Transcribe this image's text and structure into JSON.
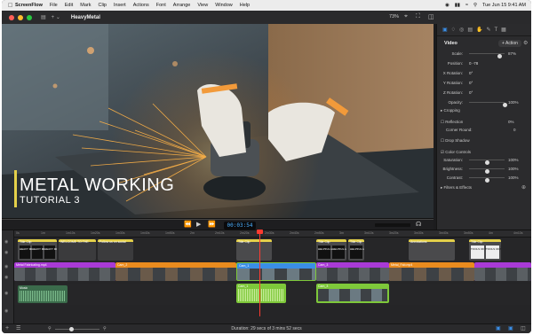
{
  "menubar": {
    "app_name": "ScreenFlow",
    "items": [
      "File",
      "Edit",
      "Mark",
      "Clip",
      "Insert",
      "Actions",
      "Font",
      "Arrange",
      "View",
      "Window",
      "Help"
    ],
    "clock": "Tue Jun 15 9:41 AM"
  },
  "titlebar": {
    "document_title": "HeavyMetal",
    "zoom": "73%"
  },
  "video": {
    "title_line1": "METAL WORKING",
    "title_line2": "TUTORIAL 3"
  },
  "transport": {
    "timecode": "00:03:54"
  },
  "inspector": {
    "section_title": "Video",
    "action_button": "+ Action",
    "rows": [
      {
        "label": "Scale:",
        "value": "",
        "pct": "87%",
        "slider": 0.87
      },
      {
        "label": "Position:",
        "value": "0      -78",
        "pct": ""
      },
      {
        "label": "X Rotation:",
        "value": "0°",
        "pct": ""
      },
      {
        "label": "Y Rotation:",
        "value": "0°",
        "pct": ""
      },
      {
        "label": "Z Rotation:",
        "value": "0°",
        "pct": ""
      },
      {
        "label": "Opacity:",
        "value": "",
        "pct": "100%",
        "slider": 1.0
      }
    ],
    "cropping": "Cropping",
    "reflection": "Reflection",
    "reflection_pct": "0%",
    "corner_round": "Corner Round:",
    "corner_value": "0",
    "drop_shadow": "Drop Shadow",
    "color_controls": "Color Controls",
    "color_rows": [
      {
        "label": "Saturation:",
        "pct": "100%",
        "slider": 0.5
      },
      {
        "label": "Brightness:",
        "pct": "100%",
        "slider": 0.5
      },
      {
        "label": "Contrast:",
        "pct": "100%",
        "slider": 0.5
      }
    ],
    "filters": "Filters & Effects"
  },
  "timeline": {
    "ruler": [
      "0s",
      "1m",
      "1m10s",
      "1m20s",
      "1m30s",
      "1m40s",
      "1m50s",
      "2m",
      "2m10s",
      "2m20s",
      "2m30s",
      "2m40s",
      "2m50s",
      "3m",
      "3m10s",
      "3m20s",
      "3m30s",
      "3m40s",
      "3m50s",
      "4m",
      "4m10s"
    ],
    "clips_title": [
      "Title Clip",
      "WELCOME TO THE",
      "Follow us on social",
      "Title Clip",
      "Title Clip",
      "Title Clip",
      "Annotations",
      "Title Clip"
    ],
    "clips_video": [
      "Metal Fabricating.mp4",
      "Cam_2",
      "Cam_1",
      "Cam_3",
      "Metal_Fab.mp4"
    ],
    "clips_audio": [
      "Music",
      "Cam_1",
      "Cam_3"
    ],
    "thumb_labels": [
      "HEAVY METAL",
      "HEAVY METAL",
      "HEAVY METAL",
      "HELPFUL HOW TO",
      "HELPFUL HOW TO",
      "HELPFUL HOW TO",
      "TOOLS OF THE TRADE",
      "TOOLS OF THE TRADE"
    ]
  },
  "statusbar": {
    "duration": "Duration: 29 secs of 3 mins 52 secs"
  },
  "colors": {
    "accent": "#3a8ee6",
    "purple": "#a93ad6",
    "orange": "#e98b1e",
    "green": "#7ec83a",
    "playhead": "#ff3b30",
    "title_bar": "#e4d04a"
  }
}
